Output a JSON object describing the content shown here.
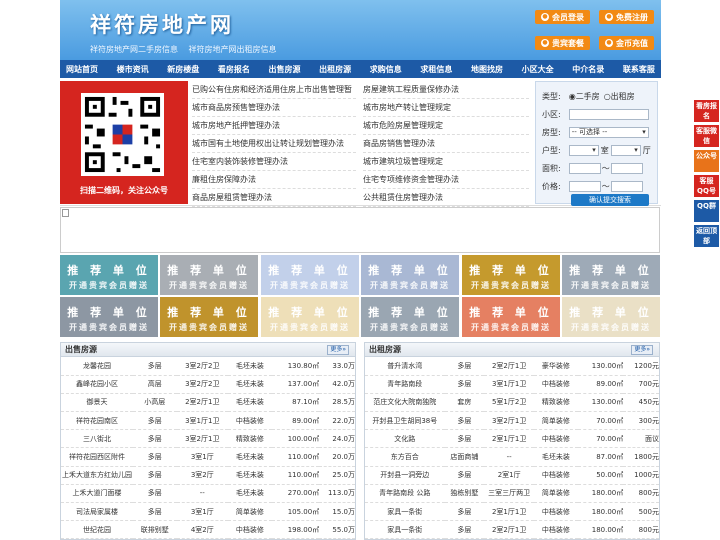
{
  "header": {
    "title": "祥符房地产网",
    "sub_links": [
      "祥符房地产网二手房信息",
      "祥符房地产网出租房信息"
    ],
    "buttons": [
      {
        "label": "会员登录"
      },
      {
        "label": "免费注册"
      },
      {
        "label": "贵宾套餐"
      },
      {
        "label": "金币充值"
      }
    ]
  },
  "nav": [
    "网站首页",
    "楼市资讯",
    "新房楼盘",
    "看房报名",
    "出售房源",
    "出租房源",
    "求购信息",
    "求租信息",
    "地图找房",
    "小区大全",
    "中介名录",
    "联系客服"
  ],
  "qr": {
    "caption": "扫描二维码，关注公众号"
  },
  "links_left": [
    "已购公有住房和经济适用住房上市出售管理暂",
    "城市商品房预售管理办法",
    "城市房地产抵押管理办法",
    "城市国有土地使用权出让转让规划管理办法",
    "住宅室内装饰装修管理办法",
    "廉租住房保障办法",
    "商品房屋租赁管理办法"
  ],
  "links_right": [
    "房屋建筑工程质量保修办法",
    "城市房地产转让管理规定",
    "城市危险房屋管理规定",
    "商品房销售管理办法",
    "城市建筑垃圾管理规定",
    "住宅专项维修资金管理办法",
    "公共租赁住房管理办法"
  ],
  "search": {
    "type_label": "类型:",
    "type_opts": [
      "二手房",
      "出租房"
    ],
    "area_label": "小区:",
    "house_type_label": "房型:",
    "house_type_value": "-- 可选择 --",
    "layout_label": "户型:",
    "room": "室",
    "hall": "厅",
    "size_label": "面积:",
    "price_label": "价格:",
    "tilde": "～",
    "submit": "确认提交搜索"
  },
  "units": {
    "title": "推 荐 单 位",
    "sub": "开通贵宾会员赠送"
  },
  "unit_colors": [
    "#5aa5b0",
    "#a9aeb4",
    "#c2d0ea",
    "#a9b8d4",
    "#c59a2d",
    "#9eaab7",
    "#8d97a3",
    "#c0932c",
    "#eedfb8",
    "#9aa6b2",
    "#e58062",
    "#eae0c6"
  ],
  "sale": {
    "title": "出售房源",
    "more": "更多»",
    "rows": [
      [
        "龙馨花园",
        "多层",
        "3室2厅2卫",
        "毛坯未装",
        "130.80㎡",
        "33.0万"
      ],
      [
        "鑫峰花园小区",
        "高层",
        "3室2厅2卫",
        "毛坯未装",
        "137.00㎡",
        "42.0万"
      ],
      [
        "御景天",
        "小高层",
        "2室2厅1卫",
        "毛坯未装",
        "87.10㎡",
        "28.5万"
      ],
      [
        "祥符花园南区",
        "多层",
        "3室1厅1卫",
        "中档装修",
        "89.00㎡",
        "22.0万"
      ],
      [
        "三八街北",
        "多层",
        "3室2厅1卫",
        "精致装修",
        "100.00㎡",
        "24.0万"
      ],
      [
        "祥符花园西区附件",
        "多层",
        "3室1厅",
        "毛坯未装",
        "110.00㎡",
        "20.0万"
      ],
      [
        "上禾大道东方红幼儿园",
        "多层",
        "3室2厅",
        "毛坯未装",
        "110.00㎡",
        "25.0万"
      ],
      [
        "上禾大道门面楼",
        "多层",
        "--",
        "毛坯未装",
        "270.00㎡",
        "113.0万"
      ],
      [
        "司法局家属楼",
        "多层",
        "3室1厅",
        "简单装修",
        "105.00㎡",
        "15.0万"
      ],
      [
        "世纪花园",
        "联排别墅",
        "4室2厅",
        "中档装修",
        "198.00㎡",
        "55.0万"
      ]
    ]
  },
  "rent": {
    "title": "出租房源",
    "more": "更多»",
    "rows": [
      [
        "普升清水湾",
        "多层",
        "2室2厅1卫",
        "豪华装修",
        "130.00㎡",
        "1200元"
      ],
      [
        "青年路南段",
        "多层",
        "3室1厅1卫",
        "中档装修",
        "89.00㎡",
        "700元"
      ],
      [
        "范庄文化大院南独院",
        "套房",
        "5室1厅2卫",
        "精致装修",
        "130.00㎡",
        "450元"
      ],
      [
        "开封县卫生胡同38号",
        "多层",
        "3室2厅1卫",
        "简单装修",
        "70.00㎡",
        "300元"
      ],
      [
        "文化路",
        "多层",
        "2室1厅1卫",
        "中档装修",
        "70.00㎡",
        "面议"
      ],
      [
        "东方百合",
        "店面商铺",
        "--",
        "毛坯未装",
        "87.00㎡",
        "1800元"
      ],
      [
        "开封县一洞旁边",
        "多层",
        "2室1厅",
        "中档装修",
        "50.00㎡",
        "1000元"
      ],
      [
        "青年路南段 公路",
        "独栋别墅",
        "三室三厅两卫",
        "简单装修",
        "180.00㎡",
        "800元"
      ],
      [
        "家具一条街",
        "多层",
        "2室1厅1卫",
        "中档装修",
        "180.00㎡",
        "500元"
      ],
      [
        "家具一条街",
        "多层",
        "2室2厅1卫",
        "中档装修",
        "180.00㎡",
        "800元"
      ]
    ]
  },
  "side": [
    "看房报名",
    "客服微信",
    "公众号",
    "客服QQ号",
    "QQ群",
    "返回顶部"
  ]
}
